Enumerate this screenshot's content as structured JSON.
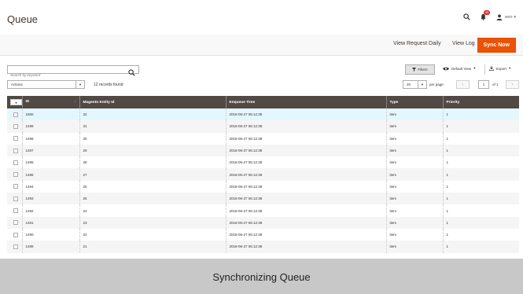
{
  "header": {
    "title": "Queue",
    "notification_count": "39",
    "user_name": "vero"
  },
  "action_bar": {
    "view_request_daily": "View Request Daily",
    "view_log": "View Log",
    "sync_now": "Sync Now"
  },
  "toolbar": {
    "search_placeholder": "Search by keyword",
    "filters_label": "Filters",
    "default_view_label": "Default View",
    "export_label": "Export",
    "actions_label": "Actions",
    "records_found": "12 records found",
    "page_size": "20",
    "per_page_label": "per page",
    "current_page": "1",
    "page_of": "of 1"
  },
  "grid": {
    "columns": [
      "ID",
      "Magento Entity Id",
      "Enqueue Time",
      "Type",
      "Priority"
    ],
    "rows": [
      {
        "id": "1500",
        "entity_id": "32",
        "time": "2018-06-27 06:12:38",
        "type": "item",
        "priority": "1"
      },
      {
        "id": "1499",
        "entity_id": "31",
        "time": "2018-06-27 06:12:38",
        "type": "item",
        "priority": "1"
      },
      {
        "id": "1498",
        "entity_id": "30",
        "time": "2018-06-27 06:12:38",
        "type": "item",
        "priority": "1"
      },
      {
        "id": "1497",
        "entity_id": "29",
        "time": "2018-06-27 06:12:38",
        "type": "item",
        "priority": "1"
      },
      {
        "id": "1496",
        "entity_id": "28",
        "time": "2018-06-27 06:12:38",
        "type": "item",
        "priority": "1"
      },
      {
        "id": "1495",
        "entity_id": "27",
        "time": "2018-06-27 06:12:38",
        "type": "item",
        "priority": "1"
      },
      {
        "id": "1494",
        "entity_id": "26",
        "time": "2018-06-27 06:12:38",
        "type": "item",
        "priority": "1"
      },
      {
        "id": "1493",
        "entity_id": "25",
        "time": "2018-06-27 06:12:38",
        "type": "item",
        "priority": "1"
      },
      {
        "id": "1492",
        "entity_id": "24",
        "time": "2018-06-27 06:12:38",
        "type": "item",
        "priority": "1"
      },
      {
        "id": "1491",
        "entity_id": "23",
        "time": "2018-06-27 06:12:38",
        "type": "item",
        "priority": "1"
      },
      {
        "id": "1490",
        "entity_id": "22",
        "time": "2018-06-27 06:12:38",
        "type": "item",
        "priority": "1"
      },
      {
        "id": "1489",
        "entity_id": "21",
        "time": "2018-06-27 06:12:38",
        "type": "item",
        "priority": "1"
      }
    ]
  },
  "caption": "Synchronizing Queue",
  "colors": {
    "accent": "#eb5202",
    "grid_header": "#514943",
    "selected_row": "#e5f7fe",
    "caption_bg": "#c8c8c8"
  }
}
